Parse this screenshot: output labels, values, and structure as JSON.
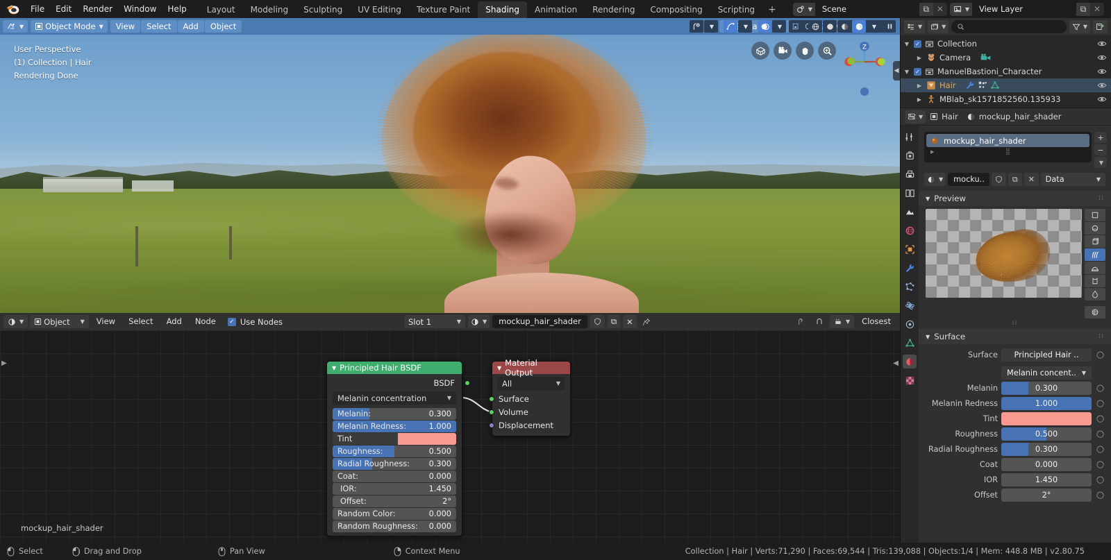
{
  "topbar": {
    "menus": [
      "File",
      "Edit",
      "Render",
      "Window",
      "Help"
    ],
    "workspaces": [
      "Layout",
      "Modeling",
      "Sculpting",
      "UV Editing",
      "Texture Paint",
      "Shading",
      "Animation",
      "Rendering",
      "Compositing",
      "Scripting"
    ],
    "active_workspace": "Shading",
    "add_workspace": "+",
    "scene_name": "Scene",
    "view_layer_name": "View Layer"
  },
  "viewport": {
    "mode": "Object Mode",
    "menus": [
      "View",
      "Select",
      "Add",
      "Object"
    ],
    "transform_orientation": "Global",
    "overlay": {
      "line1": "User Perspective",
      "line2": "(1) Collection | Hair",
      "line3": "Rendering Done"
    },
    "gizmo_axis_z": "Z"
  },
  "outliner": {
    "search_placeholder": "",
    "rows": [
      {
        "name": "Collection",
        "icon": "collection-icon",
        "indent": 0,
        "has_disclosure": true,
        "has_checkbox": true,
        "selected": false
      },
      {
        "name": "Camera",
        "icon": "camera-object-icon",
        "indent": 1,
        "has_disclosure": true,
        "has_checkbox": false,
        "selected": false
      },
      {
        "name": "ManuelBastioni_Character",
        "icon": "collection-icon",
        "indent": 0,
        "has_disclosure": true,
        "has_checkbox": true,
        "selected": false
      },
      {
        "name": "Hair",
        "icon": "mesh-data-icon",
        "indent": 1,
        "has_disclosure": true,
        "has_checkbox": false,
        "selected": true
      },
      {
        "name": "MBlab_sk1571852560.135933",
        "icon": "armature-icon",
        "indent": 1,
        "has_disclosure": true,
        "has_checkbox": false,
        "selected": false
      }
    ]
  },
  "properties": {
    "breadcrumb": [
      "Hair",
      "mockup_hair_shader"
    ],
    "material_slot": "mockup_hair_shader",
    "material_id_name": "mocku..",
    "data_dropdown": "Data",
    "preview_panel_title": "Preview",
    "preview_types": [
      "flat-plane",
      "sphere",
      "cube",
      "hair-strands",
      "shader-ball",
      "cloth",
      "fluid"
    ],
    "preview_active": "hair-strands",
    "surface_panel_title": "Surface",
    "surface_shader": "Principled Hair ..",
    "parametrization": "Melanin concent..",
    "fields": [
      {
        "label": "Surface",
        "value": "Principled Hair ..",
        "type": "value",
        "fill": 0
      },
      {
        "label": "Melanin",
        "value": "0.300",
        "type": "slider",
        "fill": 30
      },
      {
        "label": "Melanin Redness",
        "value": "1.000",
        "type": "slider",
        "fill": 100
      },
      {
        "label": "Tint",
        "value": "",
        "type": "color",
        "color": "#f89a8f"
      },
      {
        "label": "Roughness",
        "value": "0.500",
        "type": "slider",
        "fill": 50
      },
      {
        "label": "Radial Roughness",
        "value": "0.300",
        "type": "slider",
        "fill": 30
      },
      {
        "label": "Coat",
        "value": "0.000",
        "type": "slider",
        "fill": 0
      },
      {
        "label": "IOR",
        "value": "1.450",
        "type": "slider",
        "fill": 0
      },
      {
        "label": "Offset",
        "value": "2°",
        "type": "slider",
        "fill": 0
      }
    ]
  },
  "shader_editor": {
    "shader_type": "Object",
    "menus": [
      "View",
      "Select",
      "Add",
      "Node"
    ],
    "use_nodes_label": "Use Nodes",
    "use_nodes_checked": true,
    "slot": "Slot 1",
    "material_name": "mockup_hair_shader",
    "snap_mode": "Closest",
    "canvas_label": "mockup_hair_shader"
  },
  "nodes": {
    "bsdf": {
      "title": "Principled Hair BSDF",
      "header_color": "#3fad6e",
      "output_socket": "BSDF",
      "parametrization": "Melanin concentration",
      "properties": [
        {
          "label": "Melanin:",
          "value": "0.300",
          "fill": 30,
          "socket": "gray",
          "type": "slider"
        },
        {
          "label": "Melanin Redness:",
          "value": "1.000",
          "fill": 100,
          "socket": "gray",
          "type": "slider"
        },
        {
          "label": "Tint",
          "value": "",
          "fill": 0,
          "socket": "yellow",
          "type": "color",
          "color": "#f89a8f"
        },
        {
          "label": "Roughness:",
          "value": "0.500",
          "fill": 50,
          "socket": "gray",
          "type": "slider"
        },
        {
          "label": "Radial Roughness:",
          "value": "0.300",
          "fill": 30,
          "socket": "gray",
          "type": "slider"
        },
        {
          "label": "Coat:",
          "value": "0.000",
          "fill": 0,
          "socket": "gray",
          "type": "slider"
        },
        {
          "label": "IOR:",
          "value": "1.450",
          "fill": 0,
          "socket": "gray",
          "type": "slider"
        },
        {
          "label": "Offset:",
          "value": "2°",
          "fill": 0,
          "socket": "gray",
          "type": "slider"
        },
        {
          "label": "Random Color:",
          "value": "0.000",
          "fill": 0,
          "socket": "gray",
          "type": "slider"
        },
        {
          "label": "Random Roughness:",
          "value": "0.000",
          "fill": 0,
          "socket": "gray",
          "type": "slider"
        }
      ]
    },
    "material_output": {
      "title": "Material Output",
      "header_color": "#9a4848",
      "target": "All",
      "inputs": [
        {
          "label": "Surface",
          "socket": "green"
        },
        {
          "label": "Volume",
          "socket": "green"
        },
        {
          "label": "Displacement",
          "socket": "purple"
        }
      ]
    }
  },
  "statusbar": {
    "hints": [
      "Select",
      "Drag and Drop",
      "Pan View",
      "Context Menu"
    ],
    "stats": "Collection | Hair | Verts:71,290 | Faces:69,544 | Tris:139,088 | Objects:1/4 | Mem: 448.8 MB | v2.80.75"
  }
}
